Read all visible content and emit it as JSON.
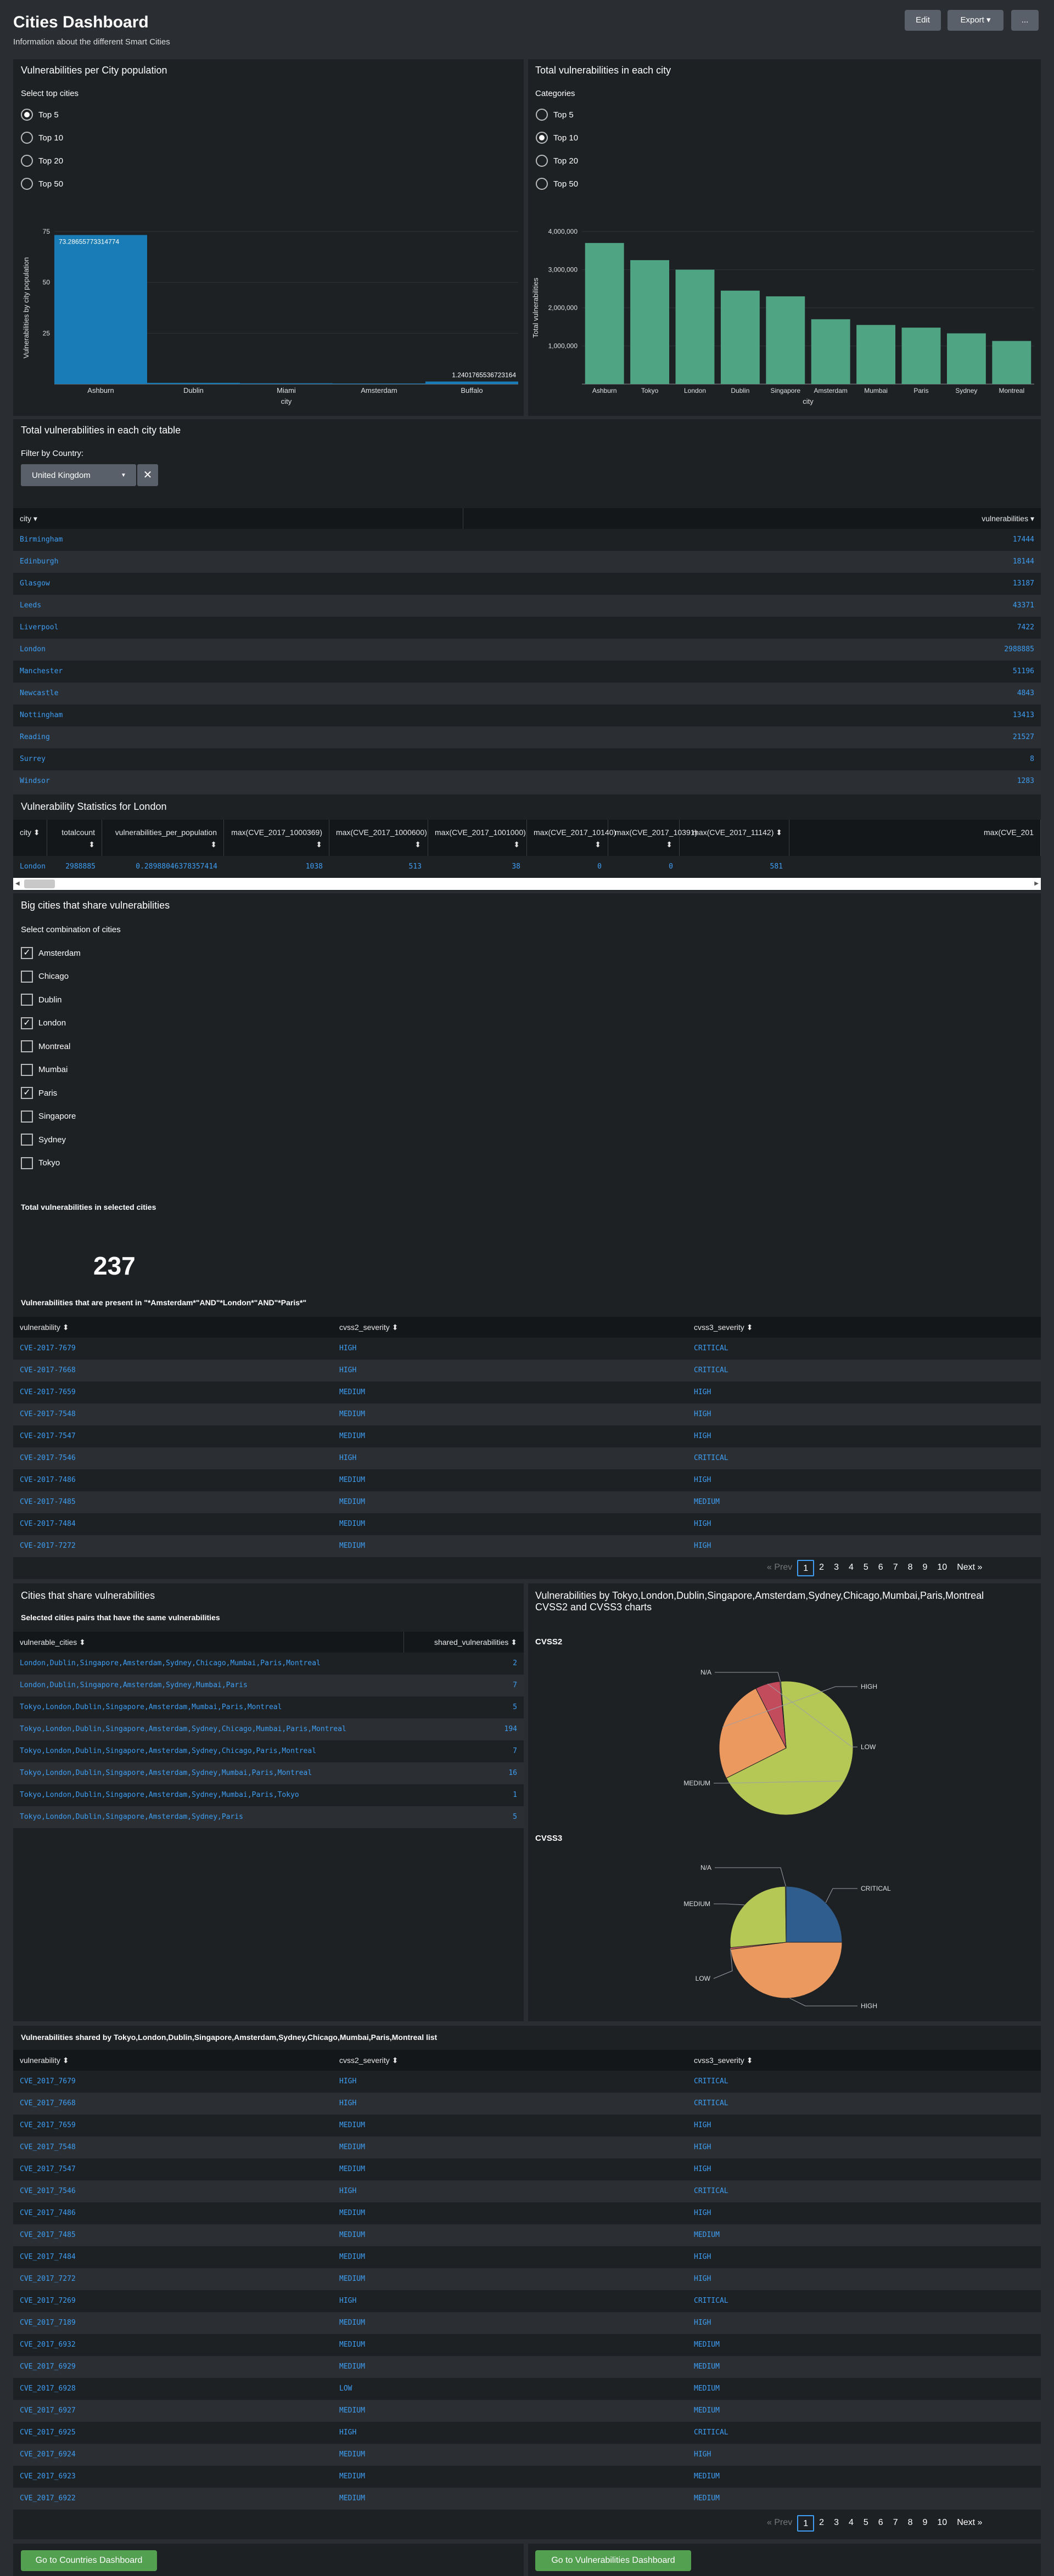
{
  "header": {
    "title": "Cities Dashboard",
    "subtitle": "Information about the different Smart Cities",
    "edit": "Edit",
    "export": "Export ▾",
    "more": "..."
  },
  "p1": {
    "title": "Vulnerabilities per City population",
    "select_label": "Select top cities",
    "options": [
      "Top 5",
      "Top 10",
      "Top 20",
      "Top 50"
    ],
    "selected": 0
  },
  "p2": {
    "title": "Total vulnerabilities in each city",
    "select_label": "Categories",
    "options": [
      "Top 5",
      "Top 10",
      "Top 20",
      "Top 50"
    ],
    "selected": 1
  },
  "chart1": {
    "type": "bar",
    "ylabel": "Vulnerabilities by city population",
    "xlabel": "city",
    "ticks": [
      "75",
      "50",
      "25"
    ],
    "ylim": [
      0,
      75
    ],
    "categories": [
      "Ashburn",
      "Dublin",
      "Miami",
      "Amsterdam",
      "Buffalo"
    ],
    "values": [
      73.28655773314775,
      0.6,
      0.4,
      0.3,
      1.2401765536723164
    ],
    "labels": [
      "73.28655773314774",
      "",
      "",
      "",
      "1.2401765536723164"
    ],
    "color": "#1a7cb7"
  },
  "chart2": {
    "type": "bar",
    "ylabel": "Total vulnerabilities",
    "xlabel": "city",
    "ticks": [
      "4,000,000",
      "3,000,000",
      "2,000,000",
      "1,000,000"
    ],
    "ylim": [
      0,
      4000000
    ],
    "categories": [
      "Ashburn",
      "Tokyo",
      "London",
      "Dublin",
      "Singapore",
      "Amsterdam",
      "Mumbai",
      "Paris",
      "Sydney",
      "Montreal"
    ],
    "values": [
      3700000,
      3250000,
      3000000,
      2450000,
      2300000,
      1700000,
      1550000,
      1480000,
      1330000,
      1130000
    ],
    "color": "#4fa484"
  },
  "city_table": {
    "title": "Total vulnerabilities in each city table",
    "filter_label": "Filter by Country:",
    "country": "United Kingdom",
    "columns": [
      "city ▾",
      "vulnerabilities ▾"
    ],
    "rows": [
      [
        "Birmingham",
        "17444"
      ],
      [
        "Edinburgh",
        "18144"
      ],
      [
        "Glasgow",
        "13187"
      ],
      [
        "Leeds",
        "43371"
      ],
      [
        "Liverpool",
        "7422"
      ],
      [
        "London",
        "2988885"
      ],
      [
        "Manchester",
        "51196"
      ],
      [
        "Newcastle",
        "4843"
      ],
      [
        "Nottingham",
        "13413"
      ],
      [
        "Reading",
        "21527"
      ],
      [
        "Surrey",
        "8"
      ],
      [
        "Windsor",
        "1283"
      ]
    ]
  },
  "stats": {
    "title": "Vulnerability Statistics for London",
    "columns": [
      "city ⬍",
      "totalcount ⬍",
      "vulnerabilities_per_population ⬍",
      "max(CVE_2017_1000369) ⬍",
      "max(CVE_2017_1000600) ⬍",
      "max(CVE_2017_1001000) ⬍",
      "max(CVE_2017_10140) ⬍",
      "max(CVE_2017_10391) ⬍",
      "max(CVE_2017_11142) ⬍",
      "max(CVE_201"
    ],
    "row": [
      "London",
      "2988885",
      "0.28988046378357414",
      "1038",
      "513",
      "38",
      "0",
      "0",
      "581",
      ""
    ]
  },
  "shared": {
    "title": "Big cities that share vulnerabilities",
    "select_label": "Select combination of cities",
    "cities": [
      "Amsterdam",
      "Chicago",
      "Dublin",
      "London",
      "Montreal",
      "Mumbai",
      "Paris",
      "Singapore",
      "Sydney",
      "Tokyo"
    ],
    "checked": [
      true,
      false,
      false,
      true,
      false,
      false,
      true,
      false,
      false,
      false
    ],
    "total_label": "Total vulnerabilities in selected cities",
    "total_value": "237",
    "present_label": "Vulnerabilities that are present in \"*Amsterdam*\"AND\"*London*\"AND\"*Paris*\"",
    "columns": [
      "vulnerability ⬍",
      "cvss2_severity ⬍",
      "cvss3_severity ⬍"
    ],
    "rows": [
      [
        "CVE-2017-7679",
        "HIGH",
        "CRITICAL"
      ],
      [
        "CVE-2017-7668",
        "HIGH",
        "CRITICAL"
      ],
      [
        "CVE-2017-7659",
        "MEDIUM",
        "HIGH"
      ],
      [
        "CVE-2017-7548",
        "MEDIUM",
        "HIGH"
      ],
      [
        "CVE-2017-7547",
        "MEDIUM",
        "HIGH"
      ],
      [
        "CVE-2017-7546",
        "HIGH",
        "CRITICAL"
      ],
      [
        "CVE-2017-7486",
        "MEDIUM",
        "HIGH"
      ],
      [
        "CVE-2017-7485",
        "MEDIUM",
        "MEDIUM"
      ],
      [
        "CVE-2017-7484",
        "MEDIUM",
        "HIGH"
      ],
      [
        "CVE-2017-7272",
        "MEDIUM",
        "HIGH"
      ]
    ],
    "pager": {
      "prev": "« Prev",
      "pages": [
        "1",
        "2",
        "3",
        "4",
        "5",
        "6",
        "7",
        "8",
        "9",
        "10"
      ],
      "next": "Next »"
    }
  },
  "cities_share": {
    "title": "Cities that share vulnerabilities",
    "sub": "Selected cities pairs that have the same vulnerabilities",
    "columns": [
      "vulnerable_cities ⬍",
      "shared_vulnerabilities ⬍"
    ],
    "rows": [
      [
        "London,Dublin,Singapore,Amsterdam,Sydney,Chicago,Mumbai,Paris,Montreal",
        "2"
      ],
      [
        "London,Dublin,Singapore,Amsterdam,Sydney,Mumbai,Paris",
        "7"
      ],
      [
        "Tokyo,London,Dublin,Singapore,Amsterdam,Mumbai,Paris,Montreal",
        "5"
      ],
      [
        "Tokyo,London,Dublin,Singapore,Amsterdam,Sydney,Chicago,Mumbai,Paris,Montreal",
        "194"
      ],
      [
        "Tokyo,London,Dublin,Singapore,Amsterdam,Sydney,Chicago,Paris,Montreal",
        "7"
      ],
      [
        "Tokyo,London,Dublin,Singapore,Amsterdam,Sydney,Mumbai,Paris,Montreal",
        "16"
      ],
      [
        "Tokyo,London,Dublin,Singapore,Amsterdam,Sydney,Mumbai,Paris,Tokyo",
        "1"
      ],
      [
        "Tokyo,London,Dublin,Singapore,Amsterdam,Sydney,Paris",
        "5"
      ]
    ]
  },
  "pies": {
    "title": "Vulnerabilities by Tokyo,London,Dublin,Singapore,Amsterdam,Sydney,Chicago,Mumbai,Paris,Montreal CVSS2 and CVSS3 charts",
    "cvss2": {
      "type": "pie",
      "title": "CVSS2",
      "slices": [
        {
          "label": "MEDIUM",
          "value": 69,
          "color": "#b5c755"
        },
        {
          "label": "HIGH",
          "value": 25,
          "color": "#ec9960"
        },
        {
          "label": "LOW",
          "value": 6,
          "color": "#c34c5c"
        },
        {
          "label": "N/A",
          "value": 0.2,
          "color": "#c9c9c9"
        }
      ]
    },
    "cvss3": {
      "type": "pie",
      "title": "CVSS3",
      "slices": [
        {
          "label": "CRITICAL",
          "value": 25,
          "color": "#2f5e8e"
        },
        {
          "label": "HIGH",
          "value": 48,
          "color": "#ec9960"
        },
        {
          "label": "LOW",
          "value": 0.5,
          "color": "#d66666"
        },
        {
          "label": "MEDIUM",
          "value": 26.3,
          "color": "#b5c755"
        },
        {
          "label": "N/A",
          "value": 0.2,
          "color": "#c9c9c9"
        }
      ]
    }
  },
  "shared_list": {
    "title": "Vulnerabilities shared by Tokyo,London,Dublin,Singapore,Amsterdam,Sydney,Chicago,Mumbai,Paris,Montreal list",
    "columns": [
      "vulnerability ⬍",
      "cvss2_severity ⬍",
      "cvss3_severity ⬍"
    ],
    "rows": [
      [
        "CVE_2017_7679",
        "HIGH",
        "CRITICAL"
      ],
      [
        "CVE_2017_7668",
        "HIGH",
        "CRITICAL"
      ],
      [
        "CVE_2017_7659",
        "MEDIUM",
        "HIGH"
      ],
      [
        "CVE_2017_7548",
        "MEDIUM",
        "HIGH"
      ],
      [
        "CVE_2017_7547",
        "MEDIUM",
        "HIGH"
      ],
      [
        "CVE_2017_7546",
        "HIGH",
        "CRITICAL"
      ],
      [
        "CVE_2017_7486",
        "MEDIUM",
        "HIGH"
      ],
      [
        "CVE_2017_7485",
        "MEDIUM",
        "MEDIUM"
      ],
      [
        "CVE_2017_7484",
        "MEDIUM",
        "HIGH"
      ],
      [
        "CVE_2017_7272",
        "MEDIUM",
        "HIGH"
      ],
      [
        "CVE_2017_7269",
        "HIGH",
        "CRITICAL"
      ],
      [
        "CVE_2017_7189",
        "MEDIUM",
        "HIGH"
      ],
      [
        "CVE_2017_6932",
        "MEDIUM",
        "MEDIUM"
      ],
      [
        "CVE_2017_6929",
        "MEDIUM",
        "MEDIUM"
      ],
      [
        "CVE_2017_6928",
        "LOW",
        "MEDIUM"
      ],
      [
        "CVE_2017_6927",
        "MEDIUM",
        "MEDIUM"
      ],
      [
        "CVE_2017_6925",
        "HIGH",
        "CRITICAL"
      ],
      [
        "CVE_2017_6924",
        "MEDIUM",
        "HIGH"
      ],
      [
        "CVE_2017_6923",
        "MEDIUM",
        "MEDIUM"
      ],
      [
        "CVE_2017_6922",
        "MEDIUM",
        "MEDIUM"
      ]
    ],
    "pager": {
      "prev": "« Prev",
      "pages": [
        "1",
        "2",
        "3",
        "4",
        "5",
        "6",
        "7",
        "8",
        "9",
        "10"
      ],
      "next": "Next »"
    }
  },
  "footer": {
    "countries": "Go to Countries Dashboard",
    "vulns": "Go to Vulnerabilities Dashboard"
  }
}
